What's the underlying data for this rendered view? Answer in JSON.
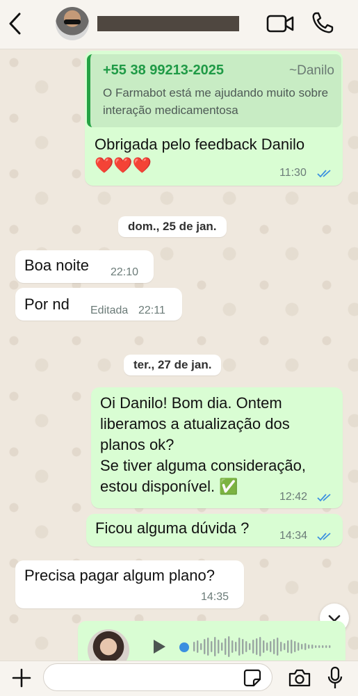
{
  "header": {
    "back_icon": "chevron-left-icon",
    "video_icon": "video-call-icon",
    "phone_icon": "phone-icon"
  },
  "messages": {
    "m1": {
      "quote_phone": "+55 38 99213-2025",
      "quote_author": "~Danilo",
      "quote_text": "O Farmabot está me ajudando muito sobre interação medicamentosa",
      "text": "Obrigada pelo feedback Danilo\n❤️❤️❤️",
      "time": "11:30"
    },
    "date1": "dom., 25 de jan.",
    "m2": {
      "text": "Boa noite",
      "time": "22:10"
    },
    "m3": {
      "text": "Por nd",
      "edited": "Editada",
      "time": "22:11"
    },
    "date2": "ter., 27 de jan.",
    "m4": {
      "text": "Oi Danilo! Bom dia. Ontem\nliberamos a atualização dos\nplanos ok?\nSe tiver alguma consideração,\nestou disponível. ✅",
      "time": "12:42"
    },
    "m5": {
      "text": "Ficou alguma dúvida ?",
      "time": "14:34"
    },
    "m6": {
      "text": "Precisa pagar algum plano?",
      "time": "14:35"
    }
  },
  "audio": {
    "play_icon": "play-icon",
    "progress": 0
  },
  "composer": {
    "input_value": "",
    "plus_icon": "plus-icon",
    "sticker_icon": "sticker-icon",
    "camera_icon": "camera-icon",
    "mic_icon": "microphone-icon"
  },
  "colors": {
    "outgoing_bubble": "#d9fdd3",
    "incoming_bubble": "#ffffff",
    "read_ticks": "#3b8fe0",
    "quote_accent": "#25a244"
  }
}
